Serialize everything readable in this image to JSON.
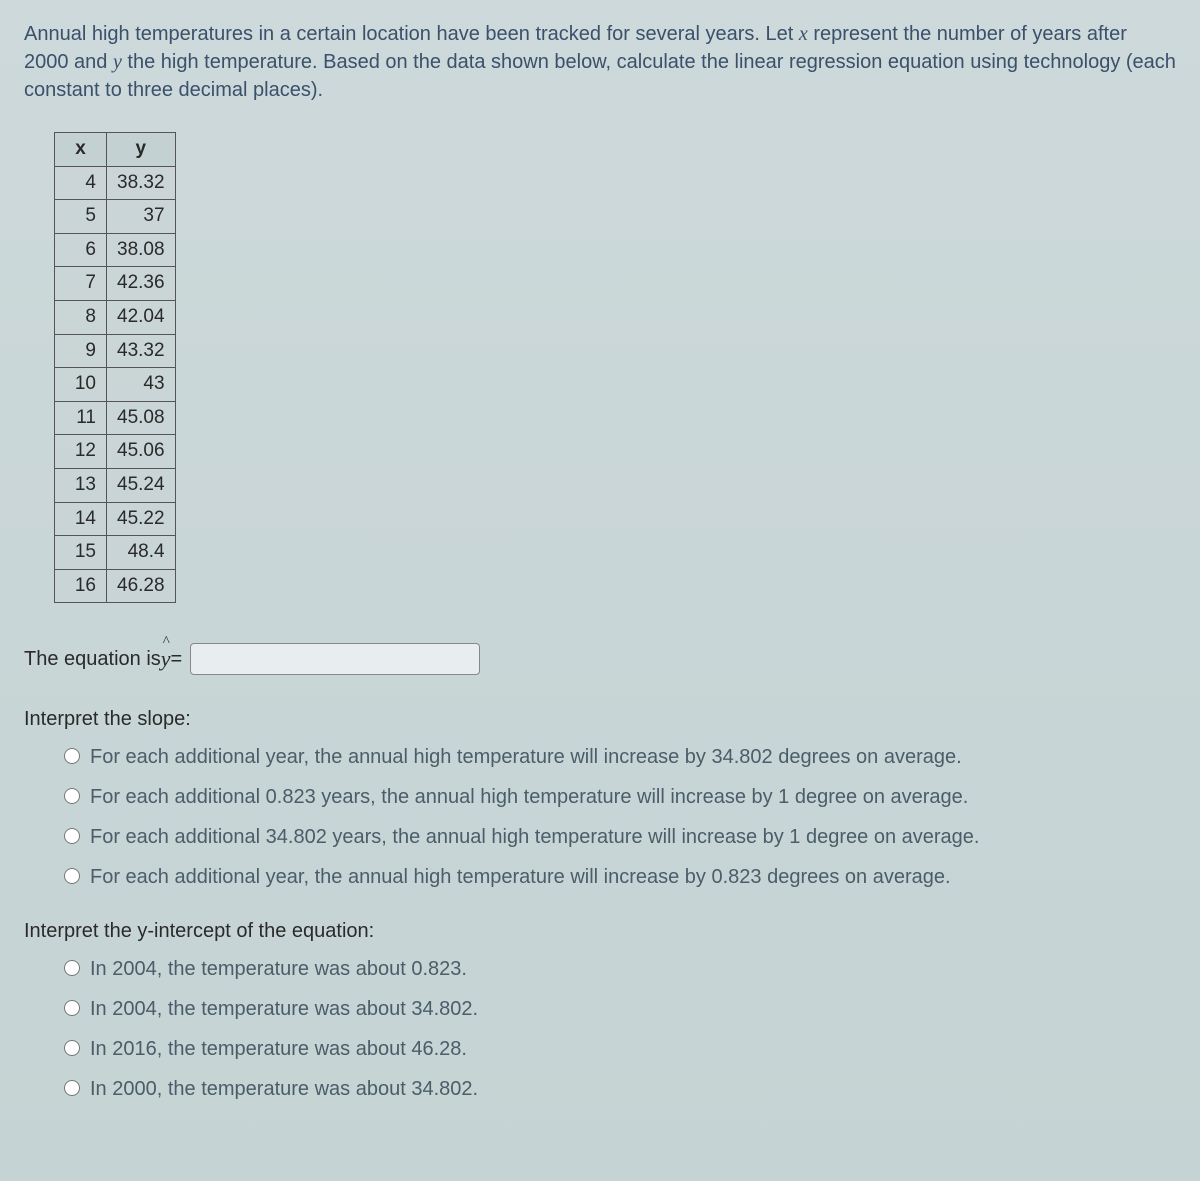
{
  "intro": {
    "part1": "Annual high temperatures in a certain location have been tracked for several years. Let ",
    "var1": "x",
    "part2": " represent the number of years after 2000 and ",
    "var2": "y",
    "part3": " the high temperature. Based on the data shown below, calculate the linear regression equation using technology (each constant to three decimal places)."
  },
  "table": {
    "headers": {
      "x": "x",
      "y": "y"
    },
    "rows": [
      {
        "x": "4",
        "y": "38.32"
      },
      {
        "x": "5",
        "y": "37"
      },
      {
        "x": "6",
        "y": "38.08"
      },
      {
        "x": "7",
        "y": "42.36"
      },
      {
        "x": "8",
        "y": "42.04"
      },
      {
        "x": "9",
        "y": "43.32"
      },
      {
        "x": "10",
        "y": "43"
      },
      {
        "x": "11",
        "y": "45.08"
      },
      {
        "x": "12",
        "y": "45.06"
      },
      {
        "x": "13",
        "y": "45.24"
      },
      {
        "x": "14",
        "y": "45.22"
      },
      {
        "x": "15",
        "y": "48.4"
      },
      {
        "x": "16",
        "y": "46.28"
      }
    ]
  },
  "equation": {
    "label_prefix": "The equation is ",
    "yhat": "ŷ",
    "equals": " = ",
    "value": ""
  },
  "slope": {
    "heading": "Interpret the slope:",
    "options": [
      "For each additional year, the annual high temperature will increase by 34.802 degrees on average.",
      "For each additional 0.823 years, the annual high temperature will increase by 1 degree on average.",
      "For each additional 34.802 years, the annual high temperature will increase by 1 degree on average.",
      "For each additional year, the annual high temperature will increase by 0.823 degrees on average."
    ]
  },
  "intercept": {
    "heading": "Interpret the y-intercept of the equation:",
    "options": [
      "In 2004, the temperature was about 0.823.",
      "In 2004, the temperature was about 34.802.",
      "In 2016, the temperature was about 46.28.",
      "In 2000, the temperature was about 34.802."
    ]
  }
}
